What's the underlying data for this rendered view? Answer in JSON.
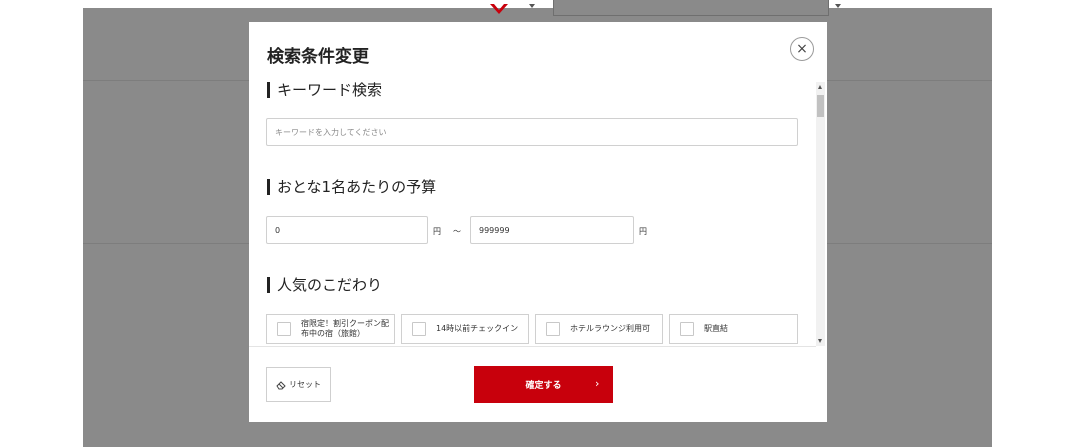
{
  "modal": {
    "title": "検索条件変更",
    "close_icon": "close-icon",
    "close_symbol": "×"
  },
  "keyword": {
    "heading": "キーワード検索",
    "placeholder": "キーワードを入力してください",
    "value": ""
  },
  "budget": {
    "heading": "おとな1名あたりの予算",
    "min_value": "0",
    "max_value": "999999",
    "unit": "円",
    "separator": "〜"
  },
  "popular": {
    "heading": "人気のこだわり",
    "options": [
      {
        "label": "宿限定！割引クーポン配布中の宿（旅館）",
        "checked": false
      },
      {
        "label": "14時以前チェックイン",
        "checked": false
      },
      {
        "label": "ホテルラウンジ利用可",
        "checked": false
      },
      {
        "label": "駅直結",
        "checked": false
      }
    ]
  },
  "footer": {
    "reset_label": "リセット",
    "reset_icon": "eraser-icon",
    "confirm_label": "確定する",
    "confirm_icon": "chevron-right-icon",
    "confirm_chevron": "›"
  },
  "colors": {
    "accent": "#c8000c",
    "overlay": "#8a8a8a"
  }
}
